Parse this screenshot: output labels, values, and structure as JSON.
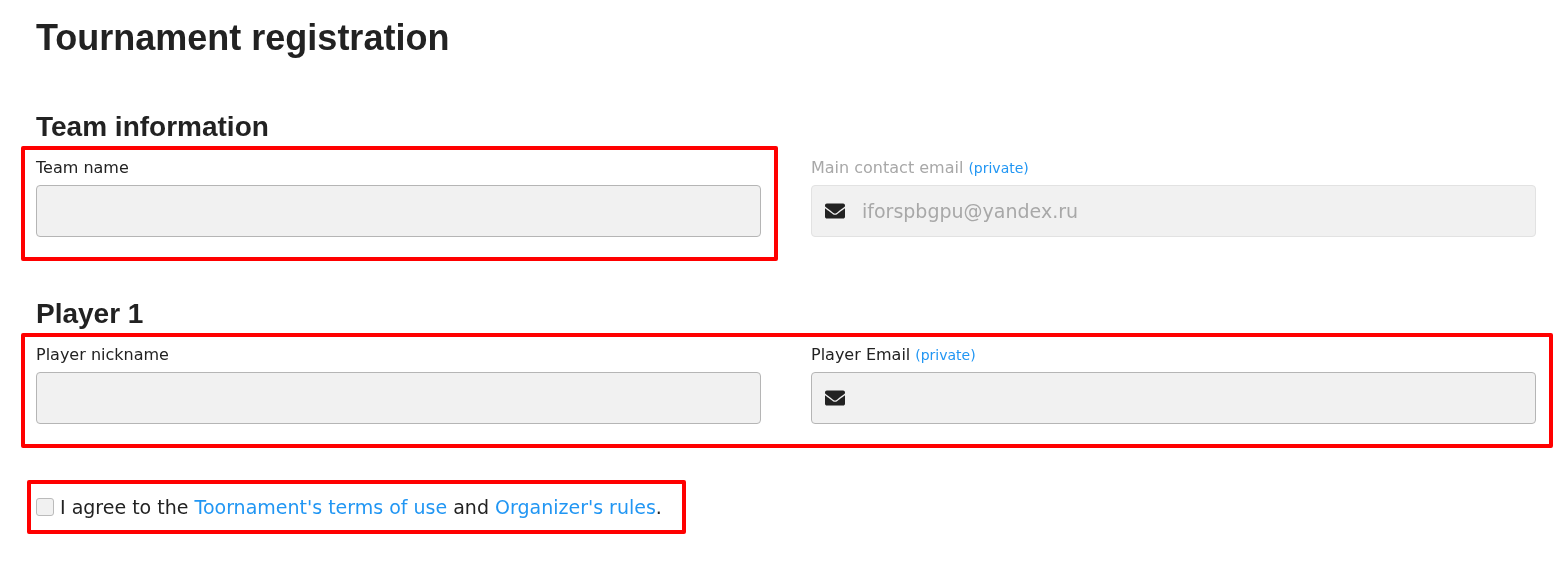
{
  "title": "Tournament registration",
  "sections": [
    {
      "title": "Team information",
      "groups": [
        {
          "highlighted": true,
          "fields": [
            {
              "label": "Team name",
              "kind": "text",
              "disabled": false
            }
          ]
        },
        {
          "highlighted": false,
          "fields": [
            {
              "label": "Main contact email",
              "note": "(private)",
              "kind": "email",
              "disabled": true,
              "value": "iforspbgpu@yandex.ru"
            }
          ]
        }
      ]
    },
    {
      "title": "Player 1",
      "groups": [
        {
          "highlighted": true,
          "fields": [
            {
              "label": "Player nickname",
              "kind": "text",
              "disabled": false
            },
            {
              "label": "Player Email",
              "note": "(private)",
              "kind": "email",
              "disabled": false
            }
          ]
        }
      ]
    }
  ],
  "agreement": {
    "highlighted": true,
    "checked": false,
    "parts": [
      {
        "kind": "text",
        "text": "I agree to the "
      },
      {
        "kind": "link",
        "text": "Toornament's terms of use"
      },
      {
        "kind": "text",
        "text": " and "
      },
      {
        "kind": "link",
        "text": "Organizer's rules"
      },
      {
        "kind": "text",
        "text": "."
      }
    ]
  }
}
